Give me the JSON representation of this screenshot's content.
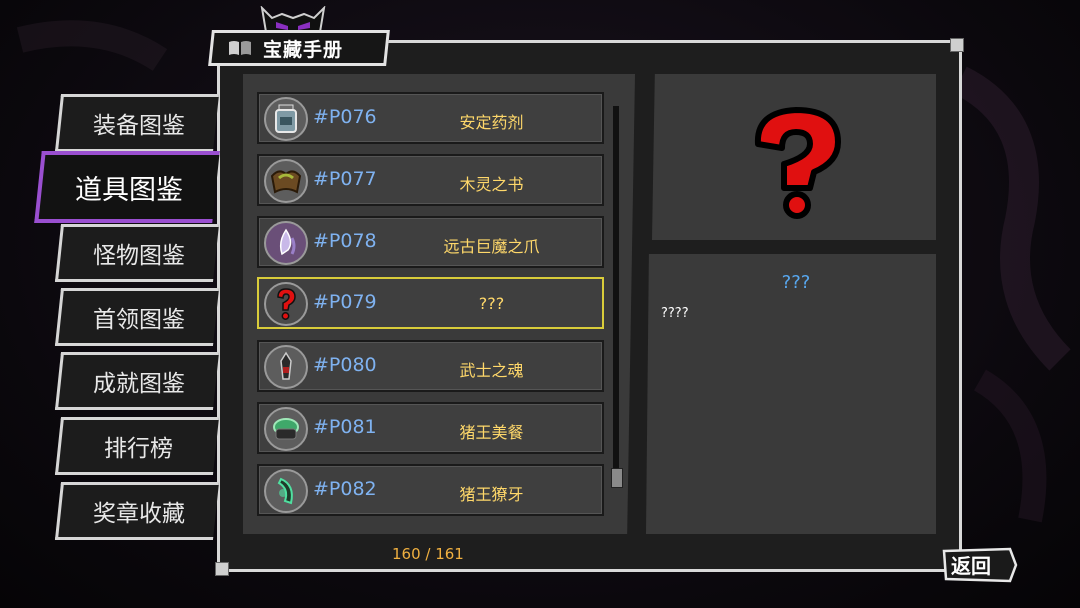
{
  "header": {
    "title": "宝藏手册",
    "title_icon": "book-icon"
  },
  "sidebar": {
    "items": [
      {
        "label": "装备图鉴",
        "active": false
      },
      {
        "label": "道具图鉴",
        "active": true
      },
      {
        "label": "怪物图鉴",
        "active": false
      },
      {
        "label": "首领图鉴",
        "active": false
      },
      {
        "label": "成就图鉴",
        "active": false
      },
      {
        "label": "排行榜",
        "active": false
      },
      {
        "label": "奖章收藏",
        "active": false
      }
    ]
  },
  "list": {
    "items": [
      {
        "code": "#P076",
        "name": "安定药剂",
        "icon": "potion-jar-icon"
      },
      {
        "code": "#P077",
        "name": "木灵之书",
        "icon": "wood-book-icon"
      },
      {
        "code": "#P078",
        "name": "远古巨魔之爪",
        "icon": "claw-icon"
      },
      {
        "code": "#P079",
        "name": "???",
        "icon": "question-mark-icon",
        "selected": true
      },
      {
        "code": "#P080",
        "name": "武士之魂",
        "icon": "samurai-soul-icon"
      },
      {
        "code": "#P081",
        "name": "猪王美餐",
        "icon": "meal-pot-icon"
      },
      {
        "code": "#P082",
        "name": "猪王獠牙",
        "icon": "tusk-icon"
      }
    ],
    "count": "160 / 161"
  },
  "detail": {
    "preview_icon": "question-mark-icon",
    "title": "???",
    "description": "????"
  },
  "back_button": {
    "label": "返回"
  },
  "colors": {
    "accent_purple": "#9a4fd0",
    "code_blue": "#7fb2f0",
    "name_gold": "#ffd86a",
    "selected_border": "#d9cc3a",
    "count_orange": "#f0b040",
    "detail_title_blue": "#58a8f0"
  }
}
